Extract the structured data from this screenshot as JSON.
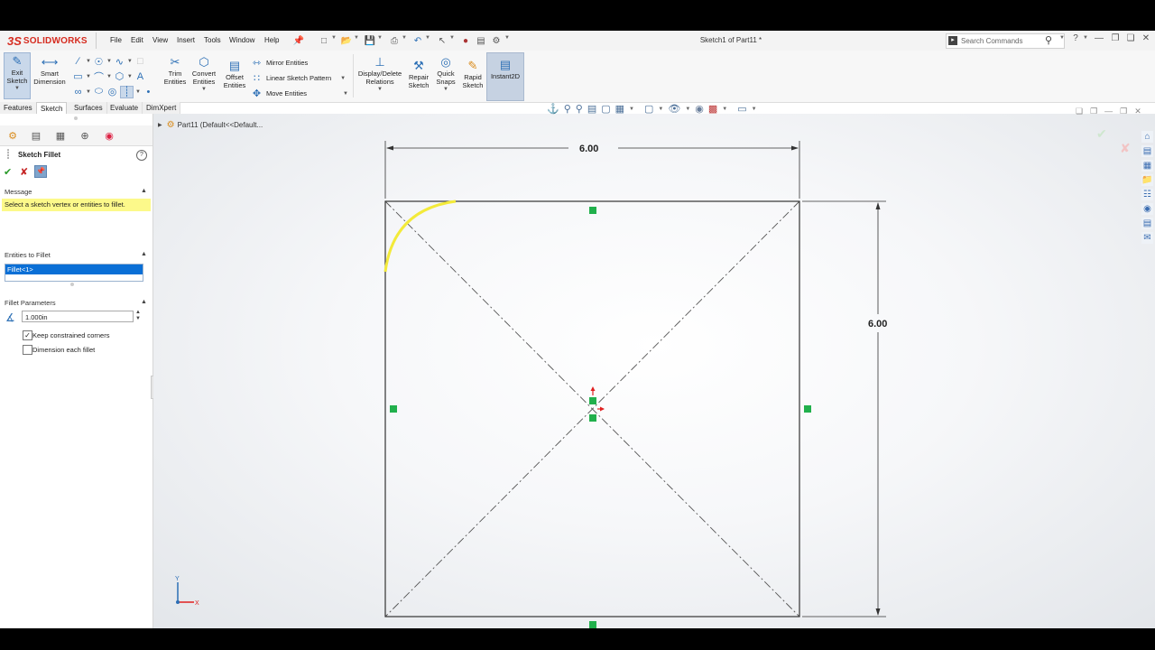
{
  "app": {
    "brand": "SOLIDWORKS",
    "document_title": "Sketch1 of Part11 *"
  },
  "menu": [
    "File",
    "Edit",
    "View",
    "Insert",
    "Tools",
    "Window",
    "Help"
  ],
  "search": {
    "placeholder": "Search Commands"
  },
  "ribbon": {
    "exit_sketch": "Exit Sketch",
    "smart_dimension": "Smart Dimension",
    "trim_entities": "Trim Entities",
    "convert_entities": "Convert Entities",
    "offset_entities": "Offset Entities",
    "mirror_entities": "Mirror Entities",
    "linear_sketch_pattern": "Linear Sketch Pattern",
    "move_entities": "Move Entities",
    "display_delete_relations": "Display/Delete Relations",
    "repair_sketch": "Repair Sketch",
    "quick_snaps": "Quick Snaps",
    "rapid_sketch": "Rapid Sketch",
    "instant2d": "Instant2D"
  },
  "command_tabs": [
    "Features",
    "Sketch",
    "Surfaces",
    "Evaluate",
    "DimXpert"
  ],
  "active_tab": "Sketch",
  "property_manager": {
    "title": "Sketch Fillet",
    "message_header": "Message",
    "message_text": "Select a sketch vertex or entities to fillet.",
    "entities_header": "Entities to Fillet",
    "entities": [
      "Fillet<1>"
    ],
    "parameters_header": "Fillet Parameters",
    "radius_value": "1.000in",
    "keep_constrained_corners": {
      "label": "Keep constrained corners",
      "checked": true
    },
    "dimension_each_fillet": {
      "label": "Dimension each fillet",
      "checked": false
    }
  },
  "feature_tree": {
    "root": "Part11  (Default<<Default..."
  },
  "sketch": {
    "width_dimension": "6.00",
    "height_dimension": "6.00"
  },
  "triad": {
    "x": "X",
    "y": "Y"
  },
  "colors": {
    "accent": "#0a6fd6",
    "fillet_preview": "#f3ea3a",
    "relation_marker": "#21b04c",
    "message_bg": "#fcf98a",
    "brand_red": "#d62b1f"
  }
}
